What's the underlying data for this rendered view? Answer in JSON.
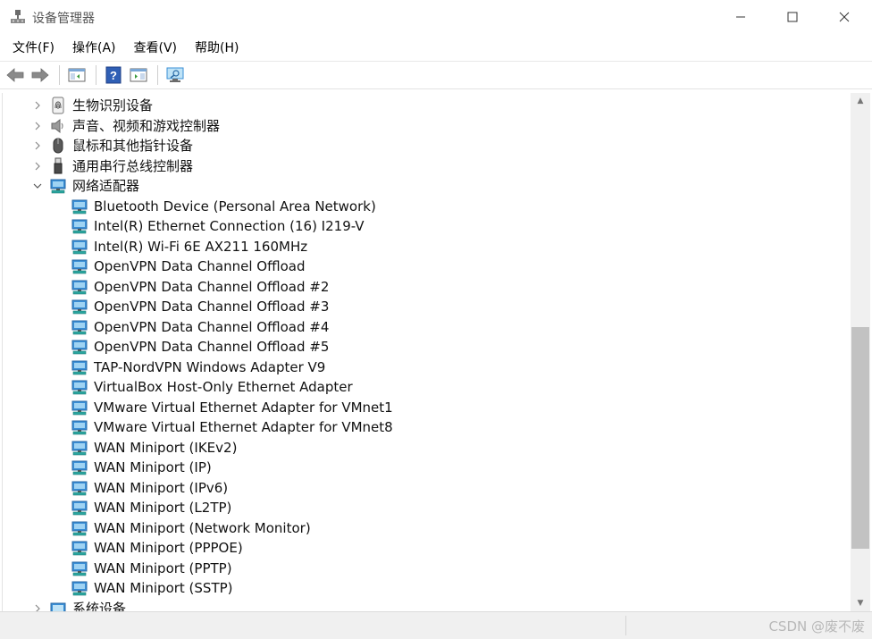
{
  "window": {
    "title": "设备管理器"
  },
  "menu": [
    {
      "label": "文件(F)"
    },
    {
      "label": "操作(A)"
    },
    {
      "label": "查看(V)"
    },
    {
      "label": "帮助(H)"
    }
  ],
  "tree": {
    "categories_before": [
      {
        "label": "生物识别设备",
        "icon": "fingerprint-icon"
      },
      {
        "label": "声音、视频和游戏控制器",
        "icon": "speaker-icon"
      },
      {
        "label": "鼠标和其他指针设备",
        "icon": "mouse-icon"
      },
      {
        "label": "通用串行总线控制器",
        "icon": "usb-icon"
      }
    ],
    "expanded_category": {
      "label": "网络适配器",
      "icon": "network-adapter-icon"
    },
    "network_adapters": [
      "Bluetooth Device (Personal Area Network)",
      "Intel(R) Ethernet Connection (16) I219-V",
      "Intel(R) Wi-Fi 6E AX211 160MHz",
      "OpenVPN Data Channel Offload",
      "OpenVPN Data Channel Offload #2",
      "OpenVPN Data Channel Offload #3",
      "OpenVPN Data Channel Offload #4",
      "OpenVPN Data Channel Offload #5",
      "TAP-NordVPN Windows Adapter V9",
      "VirtualBox Host-Only Ethernet Adapter",
      "VMware Virtual Ethernet Adapter for VMnet1",
      "VMware Virtual Ethernet Adapter for VMnet8",
      "WAN Miniport (IKEv2)",
      "WAN Miniport (IP)",
      "WAN Miniport (IPv6)",
      "WAN Miniport (L2TP)",
      "WAN Miniport (Network Monitor)",
      "WAN Miniport (PPPOE)",
      "WAN Miniport (PPTP)",
      "WAN Miniport (SSTP)"
    ],
    "categories_after": [
      {
        "label": "系统设备",
        "icon": "system-device-icon"
      }
    ]
  },
  "status": {
    "watermark": "CSDN @废不废"
  },
  "colors": {
    "adapter_icon_screen": "#3a8fd6",
    "adapter_icon_base": "#2aa6a0",
    "scroll_thumb": "#c2c2c2"
  }
}
